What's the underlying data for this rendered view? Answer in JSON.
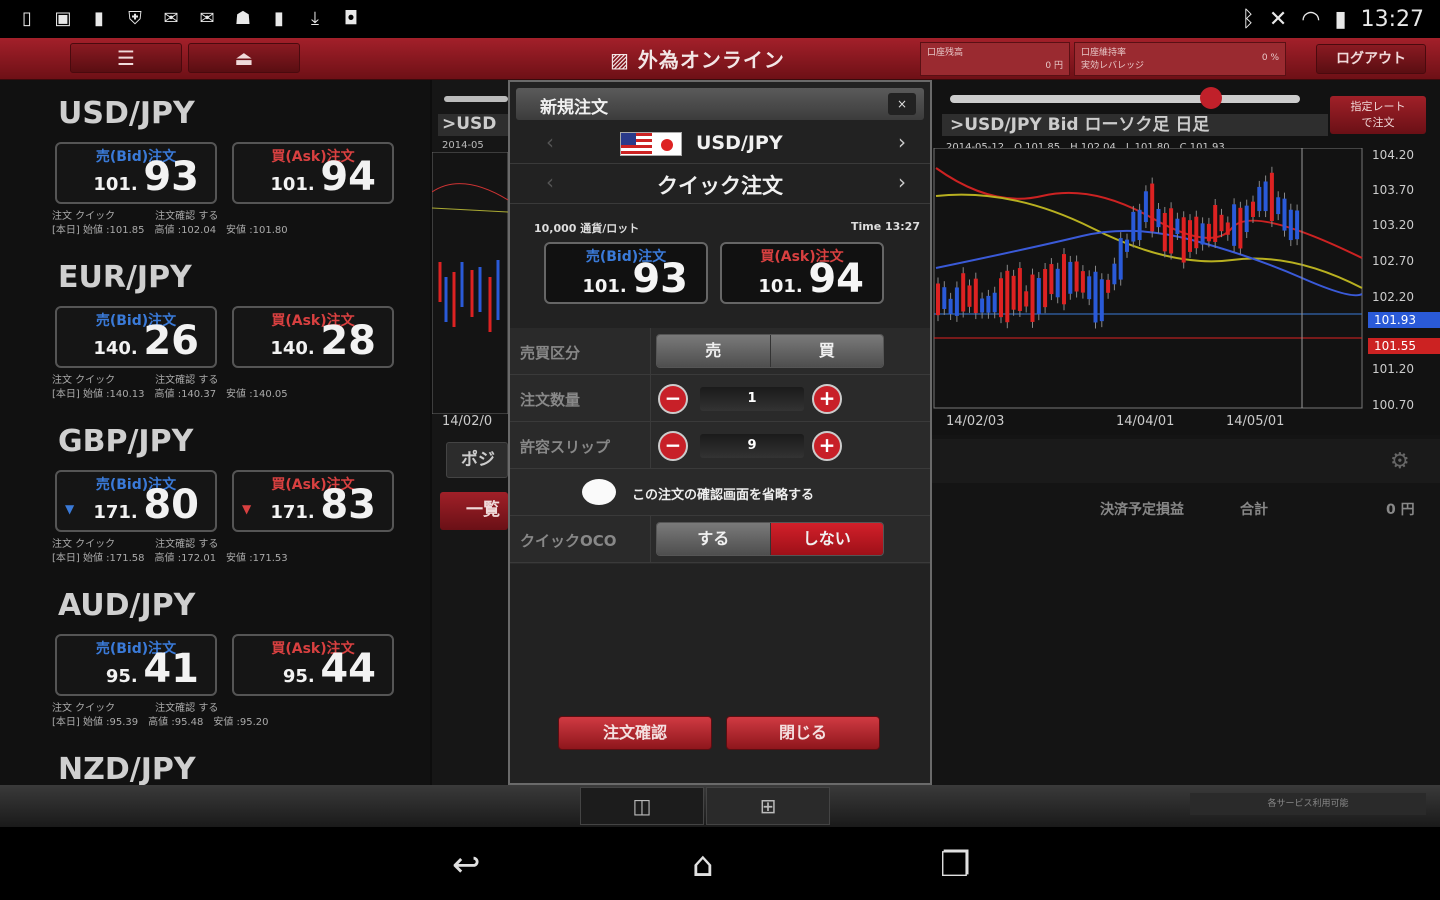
{
  "status": {
    "time": "13:27"
  },
  "appbar": {
    "logo": "外為オンライン",
    "info1_label": "口座残高",
    "info1_value": "0 円",
    "info2_label": "口座維持率",
    "info2_sub": "実効レバレッジ",
    "info2_value": "0 %",
    "logout": "ログアウト"
  },
  "pairs": [
    {
      "name": "USD/JPY",
      "bid_label": "売(Bid)注文",
      "ask_label": "買(Ask)注文",
      "bid_small": "101.",
      "bid_big": "93",
      "ask_small": "101.",
      "ask_big": "94",
      "meta1": "注文 クイック　　　　注文確認 する",
      "meta2": "[本日] 始値 :101.85　高値 :102.04　安値 :101.80"
    },
    {
      "name": "EUR/JPY",
      "bid_label": "売(Bid)注文",
      "ask_label": "買(Ask)注文",
      "bid_small": "140.",
      "bid_big": "26",
      "ask_small": "140.",
      "ask_big": "28",
      "meta1": "注文 クイック　　　　注文確認 する",
      "meta2": "[本日] 始値 :140.13　高値 :140.37　安値 :140.05"
    },
    {
      "name": "GBP/JPY",
      "bid_label": "売(Bid)注文",
      "ask_label": "買(Ask)注文",
      "bid_small": "171.",
      "bid_big": "80",
      "ask_small": "171.",
      "ask_big": "83",
      "meta1": "注文 クイック　　　　注文確認 する",
      "meta2": "[本日] 始値 :171.58　高値 :172.01　安値 :171.53"
    },
    {
      "name": "AUD/JPY",
      "bid_label": "売(Bid)注文",
      "ask_label": "買(Ask)注文",
      "bid_small": "95.",
      "bid_big": "41",
      "ask_small": "95.",
      "ask_big": "44",
      "meta1": "注文 クイック　　　　注文確認 する",
      "meta2": "[本日] 始値 :95.39　高値 :95.48　安値 :95.20"
    },
    {
      "name": "NZD/JPY"
    }
  ],
  "midpanel": {
    "title": ">USD",
    "date": "2014-05",
    "xdate": "14/02/0",
    "tab": "ポジ",
    "btn": "一覧"
  },
  "modal": {
    "title": "新規注文",
    "close": "×",
    "pair": "USD/JPY",
    "mode": "クイック注文",
    "lot": "10,000 通貨/ロット",
    "time": "Time 13:27",
    "bid_label": "売(Bid)注文",
    "ask_label": "買(Ask)注文",
    "bid_small": "101.",
    "bid_big": "93",
    "ask_small": "101.",
    "ask_big": "94",
    "side_label": "売買区分",
    "side_sell": "売",
    "side_buy": "買",
    "qty_label": "注文数量",
    "qty_value": "1",
    "slip_label": "許容スリップ",
    "slip_value": "9",
    "skip_confirm": "この注文の確認画面を省略する",
    "oco_label": "クイックOCO",
    "oco_yes": "する",
    "oco_no": "しない",
    "confirm_btn": "注文確認",
    "close_btn": "閉じる"
  },
  "chart": {
    "title": ">USD/JPY Bid ローソク足 日足",
    "rate_btn": "指定レート\nで注文",
    "ohlc": "2014-05-12　O 101.85　H 102.04　L 101.80　C 101.93",
    "yticks": [
      "104.20",
      "103.70",
      "103.20",
      "102.70",
      "102.20",
      "101.20",
      "100.70"
    ],
    "tag_bid": "101.93",
    "tag_other": "101.55",
    "xticks": [
      "14/02/03",
      "14/04/01",
      "14/05/01"
    ],
    "col1": "決済予定損益",
    "col2": "合計",
    "total": "0 円"
  },
  "bottom": {
    "note": "各サービス利用可能"
  },
  "colors": {
    "accent": "#a3202a",
    "bid": "#3a7ad8",
    "ask": "#d84040"
  }
}
